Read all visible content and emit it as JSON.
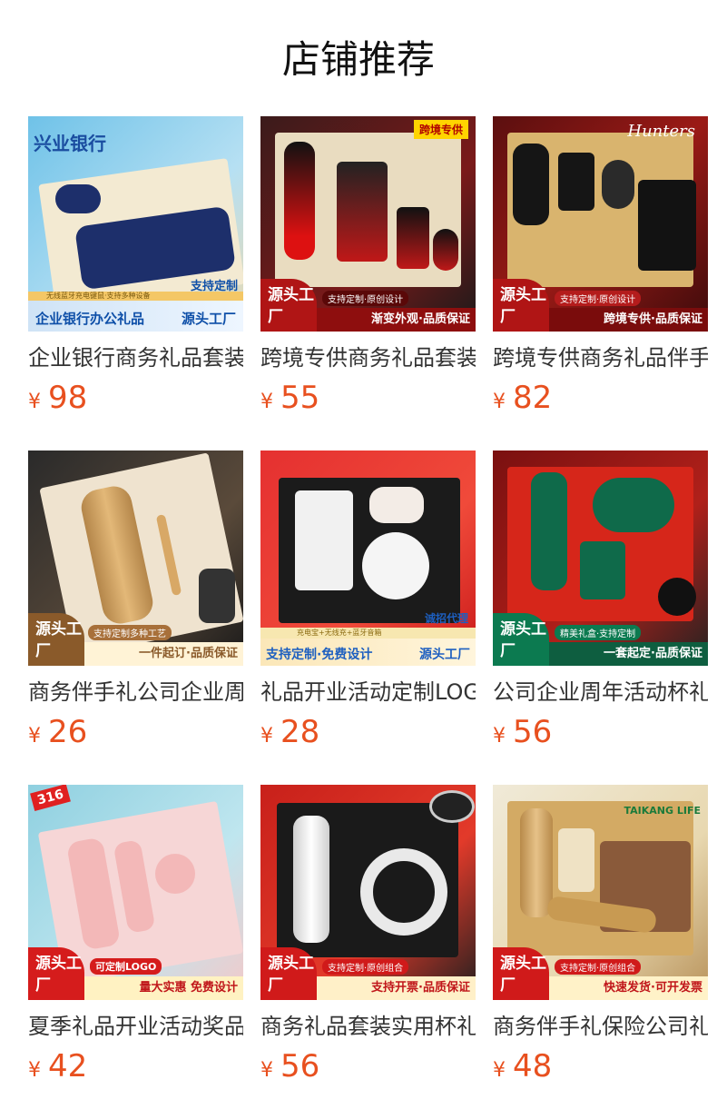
{
  "page": {
    "title": "店铺推荐"
  },
  "price_symbol": "¥",
  "products": [
    {
      "name": "企业银行商务礼品套装",
      "price": "98",
      "thumb": {
        "banner_top": "无线蓝牙充电键鼠·支持多种设备",
        "banner_left": "企业银行办公礼品",
        "banner_right_top": "支持定制",
        "banner_right": "源头工厂",
        "brand": "兴业银行"
      }
    },
    {
      "name": "跨境专供商务礼品套装",
      "price": "55",
      "thumb": {
        "badge": "源头工厂",
        "tag_small": "支持定制·原创设计",
        "tagline": "渐变外观·品质保证",
        "corner": "跨境专供"
      }
    },
    {
      "name": "跨境专供商务礼品伴手礼",
      "price": "82",
      "thumb": {
        "badge": "源头工厂",
        "tag_small": "支持定制·原创设计",
        "tagline": "跨境专供·品质保证",
        "brand": "Hunters"
      }
    },
    {
      "name": "商务伴手礼公司企业周年",
      "price": "26",
      "thumb": {
        "badge": "源头工厂",
        "tag_small": "支持定制多种工艺",
        "tagline": "一件起订·品质保证"
      }
    },
    {
      "name": "礼品开业活动定制LOGO",
      "price": "28",
      "thumb": {
        "banner_top": "充电宝+无线充+蓝牙音箱",
        "banner_left": "支持定制·免费设计",
        "banner_right_top": "诚招代理",
        "banner_right": "源头工厂"
      }
    },
    {
      "name": "公司企业周年活动杯礼盒",
      "price": "56",
      "thumb": {
        "badge": "源头工厂",
        "tag_small": "精美礼盒·支持定制",
        "tagline": "一套起定·品质保证"
      }
    },
    {
      "name": "夏季礼品开业活动奖品",
      "price": "42",
      "thumb": {
        "badge": "源头工厂",
        "tag_small": "可定制LOGO",
        "tagline": "量大实惠 免费设计",
        "corner": "316"
      }
    },
    {
      "name": "商务礼品套装实用杯礼盒",
      "price": "56",
      "thumb": {
        "badge": "源头工厂",
        "tag_small": "支持定制·原创组合",
        "tagline": "支持开票·品质保证"
      }
    },
    {
      "name": "商务伴手礼保险公司礼品",
      "price": "48",
      "thumb": {
        "badge": "源头工厂",
        "tag_small": "支持定制·原创组合",
        "tagline": "快速发货·可开发票",
        "brand": "TAIKANG LIFE"
      }
    }
  ]
}
